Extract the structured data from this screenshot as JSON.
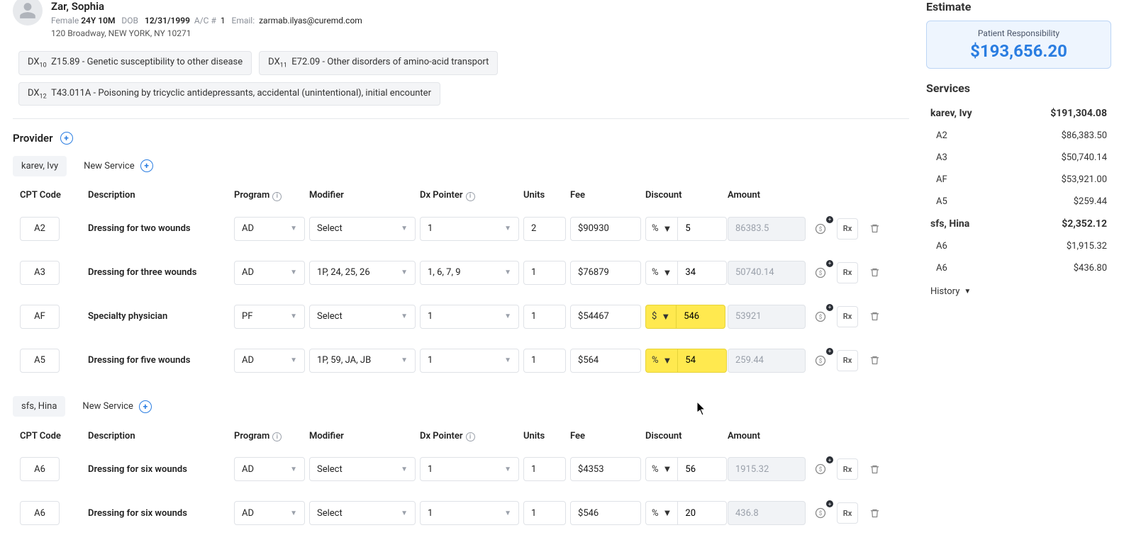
{
  "patient": {
    "name": "Zar, Sophia",
    "sex": "Female",
    "age": "24Y 10M",
    "dob_label": "DOB",
    "dob": "12/31/1999",
    "ac_label": "A/C #",
    "ac": "1",
    "email_label": "Email:",
    "email": "zarmab.ilyas@curemd.com",
    "address": "120 Broadway, NEW YORK, NY 10271"
  },
  "diagnoses": [
    {
      "num": "10",
      "code": "Z15.89",
      "desc": "Genetic susceptibility to other disease"
    },
    {
      "num": "11",
      "code": "E72.09",
      "desc": "Other disorders of amino-acid transport"
    },
    {
      "num": "12",
      "code": "T43.011A",
      "desc": "Poisoning by tricyclic antidepressants, accidental (unintentional), initial encounter"
    }
  ],
  "provider_label": "Provider",
  "new_service_label": "New Service",
  "headers": {
    "cpt": "CPT Code",
    "desc": "Description",
    "program": "Program",
    "modifier": "Modifier",
    "dx": "Dx Pointer",
    "units": "Units",
    "fee": "Fee",
    "discount": "Discount",
    "amount": "Amount"
  },
  "select_placeholder": "Select",
  "rx_label": "Rx",
  "providers": [
    {
      "name": "karev, Ivy",
      "rows": [
        {
          "cpt": "A2",
          "desc": "Dressing for two wounds",
          "program": "AD",
          "modifier": "Select",
          "dx": "1",
          "units": "2",
          "fee": "90930",
          "dtype": "%",
          "dval": "5",
          "amount": "86383.5",
          "hl": false
        },
        {
          "cpt": "A3",
          "desc": "Dressing for three wounds",
          "program": "AD",
          "modifier": "1P, 24, 25, 26",
          "dx": "1, 6, 7, 9",
          "units": "1",
          "fee": "76879",
          "dtype": "%",
          "dval": "34",
          "amount": "50740.14",
          "hl": false
        },
        {
          "cpt": "AF",
          "desc": "Specialty physician",
          "program": "PF",
          "modifier": "Select",
          "dx": "1",
          "units": "1",
          "fee": "54467",
          "dtype": "$",
          "dval": "546",
          "amount": "53921",
          "hl": true
        },
        {
          "cpt": "A5",
          "desc": "Dressing for five wounds",
          "program": "AD",
          "modifier": "1P, 59, JA, JB",
          "dx": "1",
          "units": "1",
          "fee": "564",
          "dtype": "%",
          "dval": "54",
          "amount": "259.44",
          "hl": true
        }
      ]
    },
    {
      "name": "sfs, Hina",
      "rows": [
        {
          "cpt": "A6",
          "desc": "Dressing for six wounds",
          "program": "AD",
          "modifier": "Select",
          "dx": "1",
          "units": "1",
          "fee": "4353",
          "dtype": "%",
          "dval": "56",
          "amount": "1915.32",
          "hl": false
        },
        {
          "cpt": "A6",
          "desc": "Dressing for six wounds",
          "program": "AD",
          "modifier": "Select",
          "dx": "1",
          "units": "1",
          "fee": "546",
          "dtype": "%",
          "dval": "20",
          "amount": "436.8",
          "hl": false
        }
      ]
    }
  ],
  "estimate": {
    "title": "Estimate",
    "box_label": "Patient Responsibility",
    "box_value": "$193,656.20",
    "services_label": "Services",
    "groups": [
      {
        "name": "karev, Ivy",
        "total": "$191,304.08",
        "items": [
          {
            "code": "A2",
            "amt": "$86,383.50"
          },
          {
            "code": "A3",
            "amt": "$50,740.14"
          },
          {
            "code": "AF",
            "amt": "$53,921.00"
          },
          {
            "code": "A5",
            "amt": "$259.44"
          }
        ]
      },
      {
        "name": "sfs, Hina",
        "total": "$2,352.12",
        "items": [
          {
            "code": "A6",
            "amt": "$1,915.32"
          },
          {
            "code": "A6",
            "amt": "$436.80"
          }
        ]
      }
    ],
    "history_label": "History"
  }
}
